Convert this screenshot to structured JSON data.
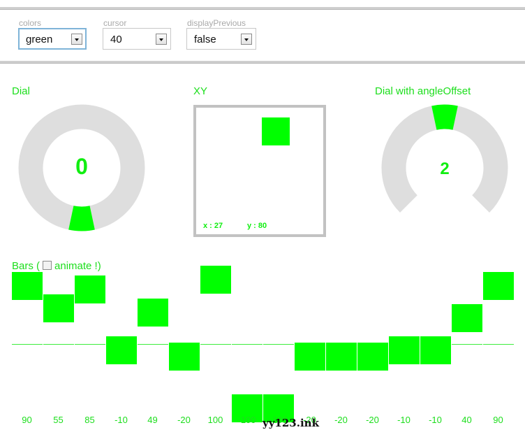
{
  "toolbar": {
    "colors": {
      "label": "colors",
      "value": "green"
    },
    "cursor": {
      "label": "cursor",
      "value": "40"
    },
    "displayPrevious": {
      "label": "displayPrevious",
      "value": "false"
    }
  },
  "dial": {
    "title": "Dial",
    "value": "0",
    "level": 0
  },
  "xy": {
    "title": "XY",
    "x_text": "x : 27",
    "y_text": "y : 80",
    "x": 27,
    "y": 80
  },
  "dial_offset": {
    "title": "Dial with angleOffset",
    "value": "2",
    "level": 2
  },
  "bars": {
    "title_prefix": "Bars (",
    "title_suffix": "animate !)",
    "checkbox_checked": false,
    "values": [
      90,
      55,
      85,
      -10,
      49,
      -20,
      100,
      -100,
      -100,
      -20,
      -20,
      -20,
      -10,
      -10,
      40,
      90
    ],
    "labels": [
      "90",
      "55",
      "85",
      "-10",
      "49",
      "-20",
      "100",
      "-100",
      "-100",
      "-20",
      "-20",
      "-20",
      "-10",
      "-10",
      "40",
      "90"
    ]
  },
  "watermark": "yy123.ink",
  "colors": {
    "accent": "#00ff00",
    "text": "#1cde1c",
    "track": "#dedede"
  },
  "icons": {
    "select_arrow": "chevron-down-icon"
  }
}
